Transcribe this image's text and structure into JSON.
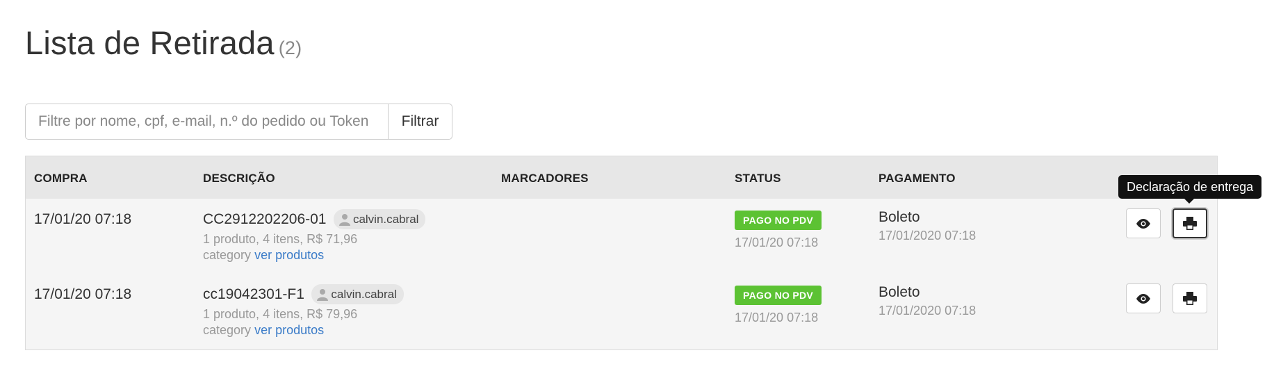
{
  "header": {
    "title": "Lista de Retirada",
    "count": "(2)"
  },
  "filter": {
    "placeholder": "Filtre por nome, cpf, e-mail, n.º do pedido ou Token",
    "value": "",
    "button_label": "Filtrar"
  },
  "table": {
    "columns": [
      "COMPRA",
      "DESCRIÇÃO",
      "MARCADORES",
      "STATUS",
      "PAGAMENTO"
    ],
    "rows": [
      {
        "compra": "17/01/20 07:18",
        "code": "CC2912202206-01",
        "user": "calvin.cabral",
        "summary": "1 produto, 4 itens, R$ 71,96",
        "category_label": "category",
        "link_label": "ver produtos",
        "status": "PAGO NO PDV",
        "status_date": "17/01/20 07:18",
        "payment": "Boleto",
        "payment_date": "17/01/2020 07:18"
      },
      {
        "compra": "17/01/20 07:18",
        "code": "cc19042301-F1",
        "user": "calvin.cabral",
        "summary": "1 produto, 4 itens, R$ 79,96",
        "category_label": "category",
        "link_label": "ver produtos",
        "status": "PAGO NO PDV",
        "status_date": "17/01/20 07:18",
        "payment": "Boleto",
        "payment_date": "17/01/2020 07:18"
      }
    ]
  },
  "tooltip": {
    "text": "Declaração de entrega"
  },
  "icons": {
    "view": "eye-icon",
    "print": "printer-icon",
    "user": "user-icon"
  },
  "colors": {
    "status_badge": "#5cc233",
    "link": "#3a7bc8",
    "header_bg": "#e7e7e7"
  }
}
